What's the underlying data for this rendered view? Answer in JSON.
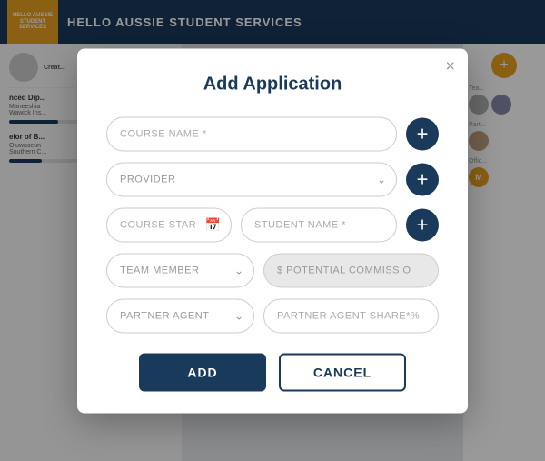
{
  "background": {
    "header_title": "HELLO AUSSIE STUDENT SERVICES",
    "logo_text": "HELLO AUSSIE STUDENT SERVICES"
  },
  "modal": {
    "title": "Add Application",
    "close_label": "×",
    "fields": {
      "course_name_placeholder": "COURSE NAME *",
      "provider_placeholder": "PROVIDER",
      "course_start_placeholder": "COURSE START DA",
      "student_name_placeholder": "STUDENT NAME *",
      "team_member_placeholder": "TEAM MEMBER",
      "potential_commission_placeholder": "$ POTENTIAL COMMISSIO",
      "partner_agent_placeholder": "PARTNER AGENT",
      "partner_agent_share_placeholder": "PARTNER AGENT SHARE*%"
    },
    "buttons": {
      "add_label": "ADD",
      "cancel_label": "CANCEL"
    }
  }
}
